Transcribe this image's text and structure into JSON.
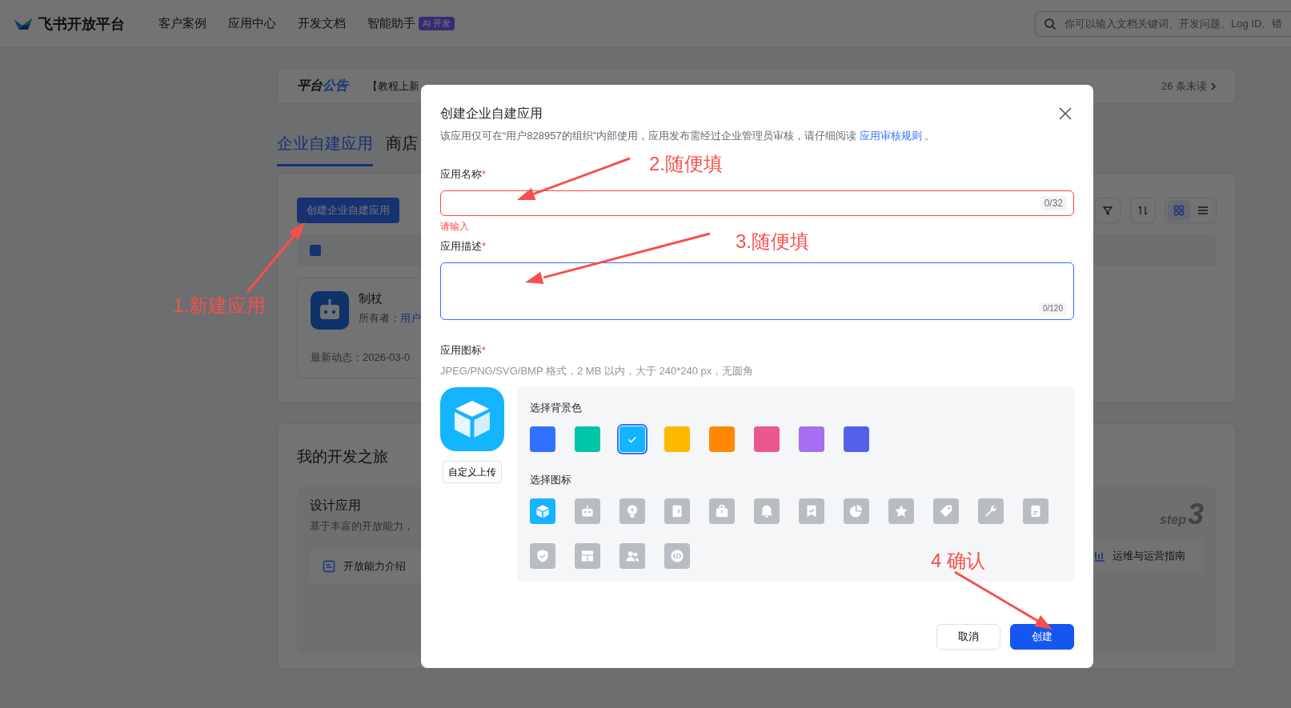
{
  "nav": {
    "logo": "飞书开放平台",
    "items": [
      {
        "label": "客户案例"
      },
      {
        "label": "应用中心"
      },
      {
        "label": "开发文档"
      },
      {
        "label": "智能助手",
        "badge": "AI 开发"
      }
    ],
    "search": {
      "placeholder": "你可以输入文档关键词、开发问题、Log ID、错"
    }
  },
  "announcement": {
    "title": "平台",
    "title_accent": "公告",
    "text": "【教程上新",
    "unread": "26 条未读"
  },
  "tabs": [
    {
      "label": "企业自建应用",
      "selected": true
    },
    {
      "label": "商店",
      "selected": false
    }
  ],
  "apps_panel": {
    "create_button": "创建企业自建应用",
    "app": {
      "name": "制杖",
      "owner_label": "所有者：",
      "owner": "用户",
      "activity": "最新动态：2026-03-0"
    }
  },
  "journey": {
    "title": "我的开发之旅",
    "card": {
      "title": "设计应用",
      "desc": "基于丰富的开放能力，",
      "link": "开放能力介绍"
    },
    "step_label": "step",
    "step_number": "3",
    "guide": "运维与运营指南"
  },
  "modal": {
    "title": "创建企业自建应用",
    "desc": "该应用仅可在“用户828957的组织”内部使用，应用发布需经过企业管理员审核，请仔细阅读",
    "desc_link": "应用审核规则",
    "desc_end": "。",
    "name_field": {
      "label": "应用名称",
      "required_mark": "*",
      "counter": "0/32",
      "error": "请输入"
    },
    "desc_field": {
      "label": "应用描述",
      "required_mark": "*",
      "counter": "0/120"
    },
    "icon_field": {
      "label": "应用图标",
      "required_mark": "*",
      "hint": "JPEG/PNG/SVG/BMP 格式，2 MB 以内，大于 240*240 px，无圆角",
      "upload_button": "自定义上传",
      "bg_title": "选择背景色",
      "icon_title": "选择图标"
    },
    "swatches": [
      {
        "color": "#3370ff",
        "selected": false
      },
      {
        "color": "#00c4a8",
        "selected": false
      },
      {
        "color": "#14b4ff",
        "selected": true
      },
      {
        "color": "#ffb800",
        "selected": false
      },
      {
        "color": "#ff8800",
        "selected": false
      },
      {
        "color": "#e8588f",
        "selected": false
      },
      {
        "color": "#a66ef0",
        "selected": false
      },
      {
        "color": "#5560e8",
        "selected": false
      }
    ],
    "icons": [
      {
        "kind": "cube",
        "selected": true
      },
      {
        "kind": "robot",
        "selected": false
      },
      {
        "kind": "bulb",
        "selected": false
      },
      {
        "kind": "door",
        "selected": false
      },
      {
        "kind": "briefcase",
        "selected": false
      },
      {
        "kind": "bell",
        "selected": false
      },
      {
        "kind": "bookmark",
        "selected": false
      },
      {
        "kind": "pie",
        "selected": false
      },
      {
        "kind": "star",
        "selected": false
      },
      {
        "kind": "tag",
        "selected": false
      },
      {
        "kind": "wrench",
        "selected": false
      },
      {
        "kind": "document",
        "selected": false
      },
      {
        "kind": "shield",
        "selected": false
      },
      {
        "kind": "layout",
        "selected": false
      },
      {
        "kind": "people",
        "selected": false
      },
      {
        "kind": "code",
        "selected": false
      }
    ],
    "cancel_button": "取消",
    "create_button": "创建"
  },
  "annotations": [
    {
      "text": "1.新建应用"
    },
    {
      "text": "2.随便填"
    },
    {
      "text": "3.随便填"
    },
    {
      "text": "4 确认"
    }
  ]
}
